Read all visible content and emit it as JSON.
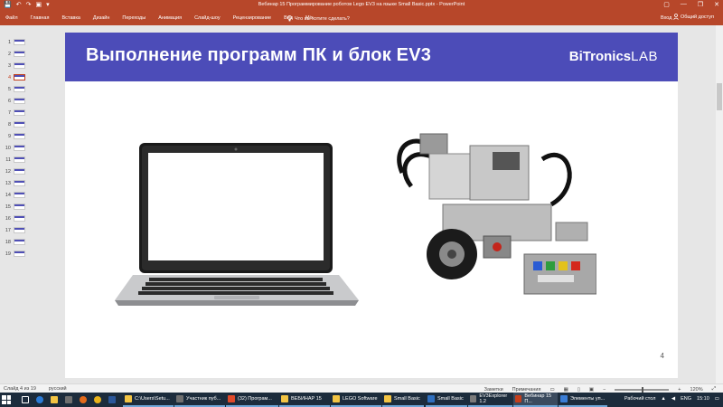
{
  "titlebar": {
    "doc_title": "Вебинар 15 Программирование роботов Lego EV3 на языке Small Basic.pptx - PowerPoint",
    "qat": [
      "💾",
      "↶",
      "↷",
      "▣",
      "▾"
    ],
    "controls": [
      "▢",
      "—",
      "❐",
      "✕"
    ]
  },
  "ribbon": {
    "tabs": [
      "Файл",
      "Главная",
      "Вставка",
      "Дизайн",
      "Переходы",
      "Анимация",
      "Слайд-шоу",
      "Рецензирование",
      "Вид",
      "Mix"
    ],
    "tell_me": "Что вы хотите сделать?",
    "sign_in": "Вход",
    "share": "Общий доступ"
  },
  "thumbnails": [
    "1",
    "2",
    "3",
    "4",
    "5",
    "6",
    "7",
    "8",
    "9",
    "10",
    "11",
    "12",
    "13",
    "14",
    "15",
    "16",
    "17",
    "18",
    "19"
  ],
  "active_slide": 4,
  "slide": {
    "title": "Выполнение программ ПК и блок EV3",
    "brand_bold": "BiTronics",
    "brand_light": "LAB",
    "number": "4"
  },
  "status": {
    "slide_of": "Слайд 4 из 19",
    "language": "русский",
    "notes": "Заметки",
    "comments": "Примечания",
    "zoom": "120%"
  },
  "taskbar": {
    "apps": [
      {
        "label": "C:\\Users\\Setu...",
        "color": "#f3c443"
      },
      {
        "label": "Участник пуб...",
        "color": "#6f6f6f"
      },
      {
        "label": "(32) Програм...",
        "color": "#e04a2a"
      },
      {
        "label": "ВЕБИНАР 15",
        "color": "#f3c443"
      },
      {
        "label": "LEGO Software",
        "color": "#f3c443"
      },
      {
        "label": "Small Basic",
        "color": "#f3c443"
      },
      {
        "label": "Small Basic",
        "color": "#2f6fbf"
      },
      {
        "label": "EV3Explorer 1.2",
        "color": "#7a7a7a"
      },
      {
        "label": "Вебинар 15 П...",
        "color": "#c43e1c"
      },
      {
        "label": "Элементы уп...",
        "color": "#3a7dd6"
      }
    ],
    "desktop_label": "Рабочий стол",
    "lang": "ENG",
    "time": "15:10"
  },
  "colors": {
    "office_accent": "#b7472a",
    "slide_header": "#4c4cb8"
  }
}
